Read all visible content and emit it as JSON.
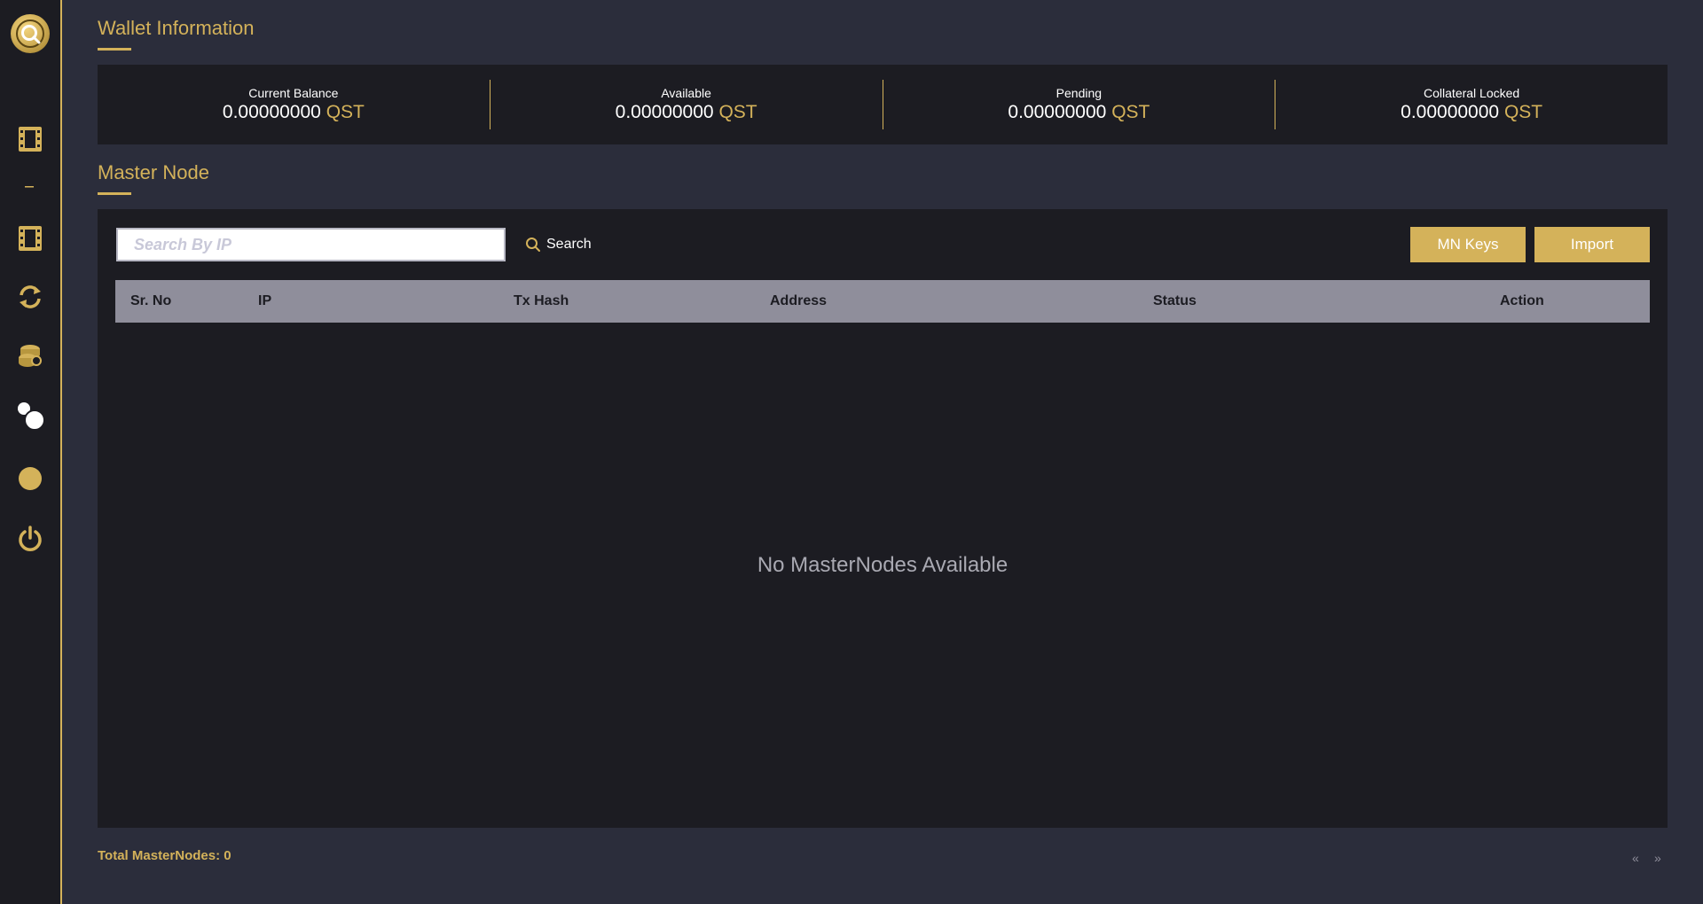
{
  "sidebar": {
    "logo": "q-logo-icon",
    "items": [
      {
        "icon": "film-strip-icon"
      },
      {
        "icon": "dash-icon"
      },
      {
        "icon": "film-strip-icon"
      },
      {
        "icon": "sync-icon"
      },
      {
        "icon": "coins-icon"
      },
      {
        "icon": "bubbles-icon"
      },
      {
        "icon": "circle-icon"
      },
      {
        "icon": "power-icon"
      }
    ]
  },
  "wallet": {
    "title": "Wallet Information",
    "stats": [
      {
        "label": "Current Balance",
        "amount": "0.00000000",
        "unit": "QST"
      },
      {
        "label": "Available",
        "amount": "0.00000000",
        "unit": "QST"
      },
      {
        "label": "Pending",
        "amount": "0.00000000",
        "unit": "QST"
      },
      {
        "label": "Collateral Locked",
        "amount": "0.00000000",
        "unit": "QST"
      }
    ]
  },
  "masternode": {
    "title": "Master Node",
    "search": {
      "placeholder": "Search By IP",
      "value": "",
      "button_label": "Search"
    },
    "buttons": {
      "mn_keys": "MN Keys",
      "import": "Import"
    },
    "columns": [
      "Sr. No",
      "IP",
      "Tx Hash",
      "Address",
      "Status",
      "Action"
    ],
    "rows": [],
    "empty_message": "No MasterNodes Available",
    "total_label": "Total MasterNodes: 0",
    "pager": {
      "prev": "«",
      "next": "»"
    }
  },
  "colors": {
    "accent": "#d4b25a",
    "panel": "#1c1c22",
    "background": "#2b2d3b",
    "header": "#8f8e9b"
  }
}
